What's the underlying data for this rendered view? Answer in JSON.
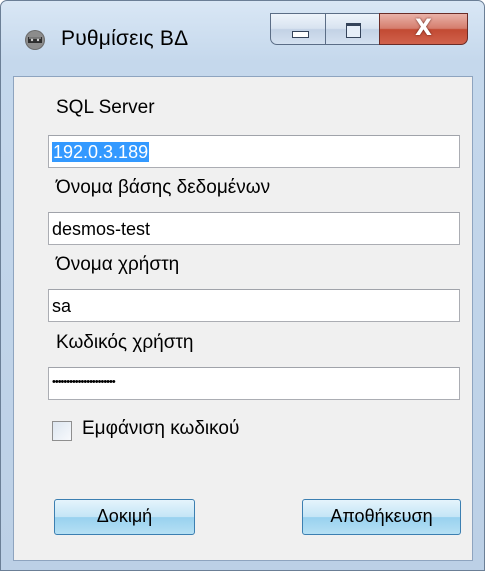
{
  "window": {
    "title": "Ρυθμίσεις ΒΔ",
    "close_glyph": "X"
  },
  "form": {
    "server_label": "SQL Server",
    "server_value": "192.0.3.189",
    "db_label": "Όνομα βάσης δεδομένων",
    "db_value": "desmos-test",
    "user_label": "Όνομα χρήστη",
    "user_value": "sa",
    "password_label": "Κωδικός χρήστη",
    "password_value": "••••••••••••••••••••••",
    "show_password_label": "Εμφάνιση κωδικού",
    "show_password_checked": false
  },
  "buttons": {
    "test_label": "Δοκιμή",
    "save_label": "Αποθήκευση"
  },
  "icons": {
    "app": "database-settings-icon",
    "minimize": "minimize-icon",
    "maximize": "maximize-icon",
    "close": "close-icon",
    "checkbox": "checkbox-icon"
  }
}
